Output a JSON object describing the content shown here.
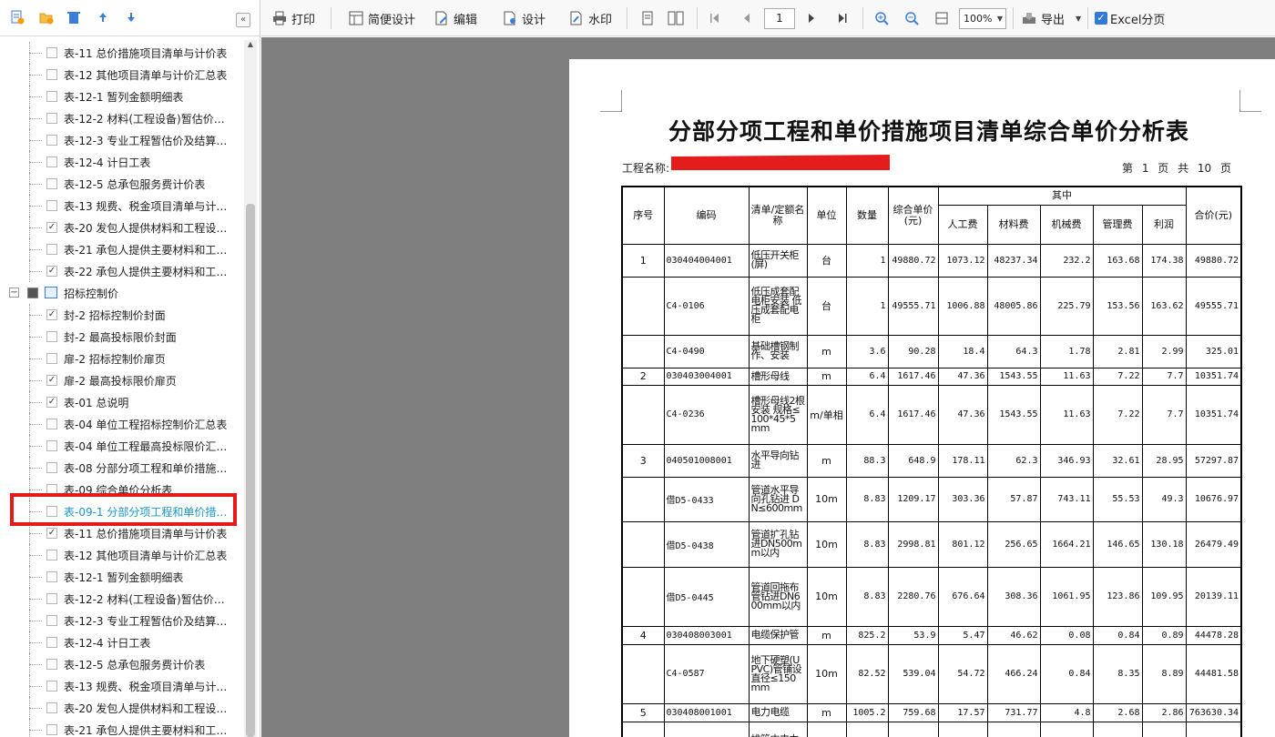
{
  "left_panel": {
    "tree_top": [
      {
        "label": "表-11 总价措施项目清单与计价表",
        "checked": false
      },
      {
        "label": "表-12 其他项目清单与计价汇总表",
        "checked": false
      },
      {
        "label": "表-12-1 暂列金额明细表",
        "checked": false
      },
      {
        "label": "表-12-2 材料(工程设备)暂估价…",
        "checked": false
      },
      {
        "label": "表-12-3 专业工程暂估价及结算…",
        "checked": false
      },
      {
        "label": "表-12-4 计日工表",
        "checked": false
      },
      {
        "label": "表-12-5 总承包服务费计价表",
        "checked": false
      },
      {
        "label": "表-13 规费、税金项目清单与计…",
        "checked": false
      },
      {
        "label": "表-20 发包人提供材料和工程设…",
        "checked": true
      },
      {
        "label": "表-21 承包人提供主要材料和工…",
        "checked": false
      },
      {
        "label": "表-22 承包人提供主要材料和工…",
        "checked": true
      }
    ],
    "group_label": "招标控制价",
    "tree_bottom": [
      {
        "label": "封-2 招标控制价封面",
        "checked": true
      },
      {
        "label": "封-2 最高投标限价封面",
        "checked": false
      },
      {
        "label": "扉-2 招标控制价扉页",
        "checked": false
      },
      {
        "label": "扉-2 最高投标限价扉页",
        "checked": true
      },
      {
        "label": "表-01 总说明",
        "checked": true
      },
      {
        "label": "表-04 单位工程招标控制价汇总表",
        "checked": false
      },
      {
        "label": "表-04 单位工程最高投标限价汇…",
        "checked": false
      },
      {
        "label": "表-08 分部分项工程和单价措施…",
        "checked": false
      },
      {
        "label": "表-09 综合单价分析表",
        "checked": false
      },
      {
        "label": "表-09-1 分部分项工程和单价措…",
        "checked": false,
        "active": true
      },
      {
        "label": "表-11 总价措施项目清单与计价表",
        "checked": true
      },
      {
        "label": "表-12 其他项目清单与计价汇总表",
        "checked": false
      },
      {
        "label": "表-12-1 暂列金额明细表",
        "checked": false
      },
      {
        "label": "表-12-2 材料(工程设备)暂估价…",
        "checked": false
      },
      {
        "label": "表-12-3 专业工程暂估价及结算…",
        "checked": false
      },
      {
        "label": "表-12-4 计日工表",
        "checked": false
      },
      {
        "label": "表-12-5 总承包服务费计价表",
        "checked": false
      },
      {
        "label": "表-13 规费、税金项目清单与计…",
        "checked": false
      },
      {
        "label": "表-20 发包人提供材料和工程设…",
        "checked": false
      },
      {
        "label": "表-21 承包人提供主要材料和工…",
        "checked": false
      }
    ]
  },
  "toolbar": {
    "print": "打印",
    "simple_design": "简便设计",
    "edit": "编辑",
    "design": "设计",
    "watermark": "水印",
    "page_number": "1",
    "zoom": "100%",
    "export": "导出",
    "excel_paging": "Excel分页"
  },
  "document": {
    "title": "分部分项工程和单价措施项目清单综合单价分析表",
    "project_label": "工程名称:",
    "page_info": "第 1 页 共 10 页",
    "headers": {
      "seq": "序号",
      "code": "编码",
      "name": "清单/定额名称",
      "unit": "单位",
      "qty": "数量",
      "unit_price": "综合单价(元)",
      "group": "其中",
      "labor": "人工费",
      "material": "材料费",
      "machine": "机械费",
      "mgmt": "管理费",
      "profit": "利润",
      "total": "合价(元)"
    },
    "rows": [
      {
        "seq": "1",
        "code": "030404004001",
        "name": "低压开关柜(屏)",
        "unit": "台",
        "qty": "1",
        "price": "49880.72",
        "labor": "1073.12",
        "material": "48237.34",
        "machine": "232.2",
        "mgmt": "163.68",
        "profit": "174.38",
        "total": "49880.72",
        "h": 36
      },
      {
        "seq": "",
        "code": "C4-0106",
        "name": "低压成套配电柜安装 低压成套配电柜",
        "unit": "台",
        "qty": "1",
        "price": "49555.71",
        "labor": "1006.88",
        "material": "48005.86",
        "machine": "225.79",
        "mgmt": "153.56",
        "profit": "163.62",
        "total": "49555.71",
        "h": 64
      },
      {
        "seq": "",
        "code": "C4-0490",
        "name": "基础槽钢制作、安装",
        "unit": "m",
        "qty": "3.6",
        "price": "90.28",
        "labor": "18.4",
        "material": "64.3",
        "machine": "1.78",
        "mgmt": "2.81",
        "profit": "2.99",
        "total": "325.01",
        "h": 36
      },
      {
        "seq": "2",
        "code": "030403004001",
        "name": "槽形母线",
        "unit": "m",
        "qty": "6.4",
        "price": "1617.46",
        "labor": "47.36",
        "material": "1543.55",
        "machine": "11.63",
        "mgmt": "7.22",
        "profit": "7.7",
        "total": "10351.74",
        "h": 19
      },
      {
        "seq": "",
        "code": "C4-0236",
        "name": "槽形母线2根安装 规格≤100*45*5mm",
        "unit": "m/单相",
        "qty": "6.4",
        "price": "1617.46",
        "labor": "47.36",
        "material": "1543.55",
        "machine": "11.63",
        "mgmt": "7.22",
        "profit": "7.7",
        "total": "10351.74",
        "h": 65
      },
      {
        "seq": "3",
        "code": "040501008001",
        "name": "水平导向钻进",
        "unit": "m",
        "qty": "88.3",
        "price": "648.9",
        "labor": "178.11",
        "material": "62.3",
        "machine": "346.93",
        "mgmt": "32.61",
        "profit": "28.95",
        "total": "57297.87",
        "h": 36
      },
      {
        "seq": "",
        "code": "借D5-0433",
        "name": "管道水平导向孔钻进 DN≤600mm",
        "unit": "10m",
        "qty": "8.83",
        "price": "1209.17",
        "labor": "303.36",
        "material": "57.87",
        "machine": "743.11",
        "mgmt": "55.53",
        "profit": "49.3",
        "total": "10676.97",
        "h": 49
      },
      {
        "seq": "",
        "code": "借D5-0438",
        "name": "管道扩孔钻进DN500mm以内",
        "unit": "10m",
        "qty": "8.83",
        "price": "2998.81",
        "labor": "801.12",
        "material": "256.65",
        "machine": "1664.21",
        "mgmt": "146.65",
        "profit": "130.18",
        "total": "26479.49",
        "h": 50
      },
      {
        "seq": "",
        "code": "借D5-0445",
        "name": "管道回拖布管钻进DN600mm以内",
        "unit": "10m",
        "qty": "8.83",
        "price": "2280.76",
        "labor": "676.64",
        "material": "308.36",
        "machine": "1061.95",
        "mgmt": "123.86",
        "profit": "109.95",
        "total": "20139.11",
        "h": 65
      },
      {
        "seq": "4",
        "code": "030408003001",
        "name": "电缆保护管",
        "unit": "m",
        "qty": "825.2",
        "price": "53.9",
        "labor": "5.47",
        "material": "46.62",
        "machine": "0.08",
        "mgmt": "0.84",
        "profit": "0.89",
        "total": "44478.28",
        "h": 20
      },
      {
        "seq": "",
        "code": "C4-0587",
        "name": "地下硬塑(UPVC)管铺设 直径≤150mm",
        "unit": "10m",
        "qty": "82.52",
        "price": "539.04",
        "labor": "54.72",
        "material": "466.24",
        "machine": "0.84",
        "mgmt": "8.35",
        "profit": "8.89",
        "total": "44481.58",
        "h": 65
      },
      {
        "seq": "5",
        "code": "030408001001",
        "name": "电力电缆",
        "unit": "m",
        "qty": "1005.2",
        "price": "759.68",
        "labor": "17.57",
        "material": "731.77",
        "machine": "4.8",
        "mgmt": "2.68",
        "profit": "2.86",
        "total": "763630.34",
        "h": 20
      },
      {
        "seq": "",
        "code": "",
        "name": "排管内电力",
        "unit": "",
        "qty": "",
        "price": "",
        "labor": "",
        "material": "",
        "machine": "",
        "mgmt": "",
        "profit": "",
        "total": "",
        "h": 40
      }
    ]
  }
}
